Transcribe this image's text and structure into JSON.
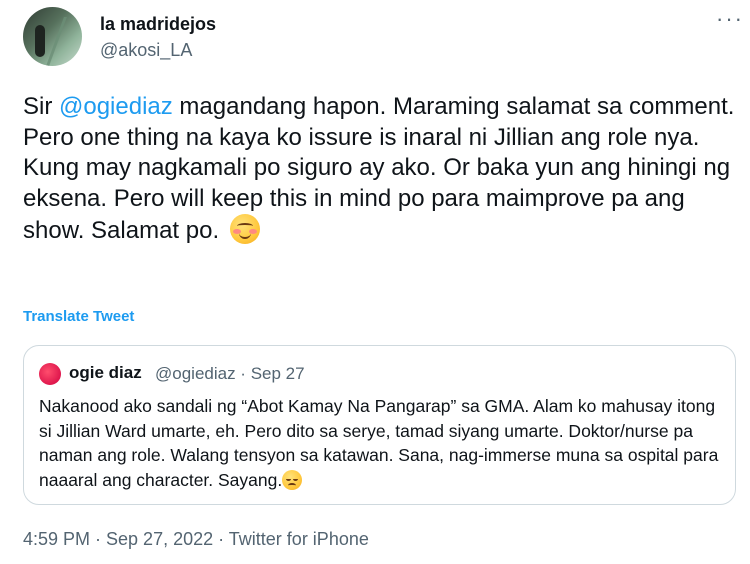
{
  "author": {
    "name": "la madridejos",
    "handle": "@akosi_LA"
  },
  "more_label": "···",
  "tweet": {
    "prefix": "Sir ",
    "mention": "@ogiediaz",
    "text": " magandang hapon. Maraming salamat sa comment. Pero one thing na kaya ko issure is inaral ni Jillian ang role nya. Kung may nagkamali po siguro ay ako. Or baka yun ang hiningi ng eksena. Pero will keep this in mind po para maimprove pa ang show. Salamat po. ",
    "emoji": "smiling-face-with-blush"
  },
  "translate_label": "Translate Tweet",
  "quote": {
    "name": "ogie diaz",
    "meta": "@ogiediaz · Sep 27",
    "text": "Nakanood ako sandali ng “Abot Kamay Na Pangarap” sa GMA. Alam ko mahusay itong si Jillian Ward umarte, eh. Pero dito sa serye, tamad siyang umarte. Doktor/nurse pa naman ang role. Walang tensyon sa katawan. Sana, nag-immerse muna sa ospital para naaaral ang character. Sayang.",
    "emoji": "pensive-face"
  },
  "footer": "4:59 PM · Sep 27, 2022 · Twitter for iPhone"
}
